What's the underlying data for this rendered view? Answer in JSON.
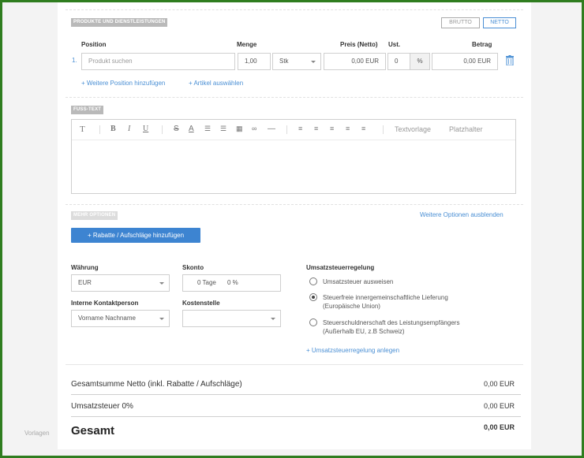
{
  "sidebar": {
    "vorlagen_label": "Vorlagen"
  },
  "products": {
    "section_title": "PRODUKTE UND DIENSTLEISTUNGEN",
    "toggle": {
      "brutto": "BRUTTO",
      "netto": "NETTO",
      "active": "netto"
    },
    "headers": {
      "position": "Position",
      "menge": "Menge",
      "preis": "Preis (Netto)",
      "ust": "Ust.",
      "betrag": "Betrag"
    },
    "row": {
      "index": "1.",
      "search_placeholder": "Produkt suchen",
      "quantity": "1,00",
      "unit": "Stk",
      "price": "0,00 EUR",
      "tax": "0",
      "tax_unit": "%",
      "amount": "0,00 EUR"
    },
    "add_position_link": "+ Weitere Position hinzufügen",
    "select_article_link": "+ Artikel auswählen"
  },
  "footer_text": {
    "section_title": "FUSS-TEXT",
    "toolbar": {
      "text_template": "Textvorlage",
      "placeholder": "Platzhalter"
    }
  },
  "more_options": {
    "section_title": "MEHR OPTIONEN",
    "hide_link": "Weitere Optionen ausblenden",
    "discount_button": "+ Rabatte / Aufschläge hinzufügen",
    "currency_label": "Währung",
    "currency_value": "EUR",
    "skonto_label": "Skonto",
    "skonto_days": "0 Tage",
    "skonto_percent": "0 %",
    "contact_label": "Interne Kontaktperson",
    "contact_value": "Vorname Nachname",
    "cost_center_label": "Kostenstelle",
    "cost_center_value": "",
    "vat_rule_label": "Umsatzsteuerregelung",
    "vat_options": [
      {
        "line1": "Umsatzsteuer ausweisen",
        "line2": "",
        "checked": false
      },
      {
        "line1": "Steuerfreie innergemeinschaftliche Lieferung",
        "line2": "(Europäische Union)",
        "checked": true
      },
      {
        "line1": "Steuerschuldnerschaft des Leistungsempfängers",
        "line2": "(Außerhalb EU, z.B Schweiz)",
        "checked": false
      }
    ],
    "add_vat_rule_link": "+ Umsatzsteuerregelung anlegen"
  },
  "totals": {
    "net_label": "Gesamtsumme Netto (inkl. Rabatte / Aufschläge)",
    "net_value": "0,00 EUR",
    "vat_label": "Umsatzsteuer 0%",
    "vat_value": "0,00 EUR",
    "total_label": "Gesamt",
    "total_value": "0,00 EUR"
  },
  "colors": {
    "accent": "#3d84d1",
    "frame": "#2f7d1f"
  }
}
